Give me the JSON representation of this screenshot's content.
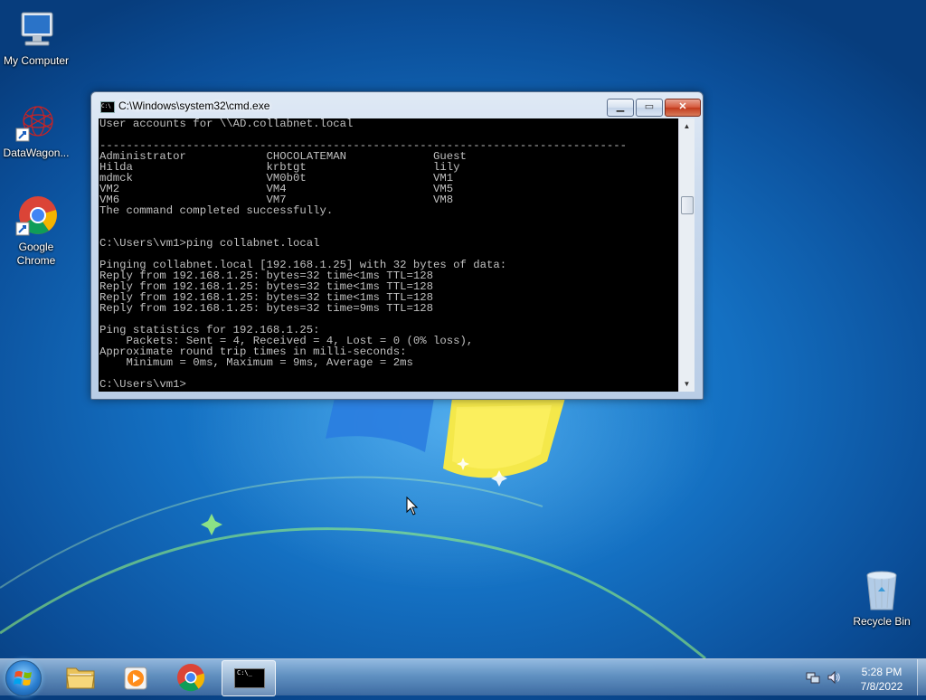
{
  "desktop": {
    "icons": [
      {
        "label": "My Computer",
        "icon": "computer-icon"
      },
      {
        "label": "DataWagon...",
        "icon": "datawagon-icon"
      },
      {
        "label": "Google Chrome",
        "icon": "chrome-icon"
      },
      {
        "label": "Recycle Bin",
        "icon": "recycle-bin-icon"
      }
    ]
  },
  "window": {
    "title": "C:\\Windows\\system32\\cmd.exe",
    "min_glyph": "▁",
    "max_glyph": "▭",
    "close_glyph": "✕",
    "console_lines": [
      "User accounts for \\\\AD.collabnet.local",
      "",
      "-------------------------------------------------------------------------------",
      "Administrator            CHOCOLATEMAN             Guest",
      "Hilda                    krbtgt                   lily",
      "mdmck                    VM0b0t                   VM1",
      "VM2                      VM4                      VM5",
      "VM6                      VM7                      VM8",
      "The command completed successfully.",
      "",
      "",
      "C:\\Users\\vm1>ping collabnet.local",
      "",
      "Pinging collabnet.local [192.168.1.25] with 32 bytes of data:",
      "Reply from 192.168.1.25: bytes=32 time<1ms TTL=128",
      "Reply from 192.168.1.25: bytes=32 time<1ms TTL=128",
      "Reply from 192.168.1.25: bytes=32 time<1ms TTL=128",
      "Reply from 192.168.1.25: bytes=32 time=9ms TTL=128",
      "",
      "Ping statistics for 192.168.1.25:",
      "    Packets: Sent = 4, Received = 4, Lost = 0 (0% loss),",
      "Approximate round trip times in milli-seconds:",
      "    Minimum = 0ms, Maximum = 9ms, Average = 2ms",
      "",
      "C:\\Users\\vm1>"
    ]
  },
  "taskbar": {
    "items": [
      {
        "icon": "file-explorer-icon"
      },
      {
        "icon": "media-player-icon"
      },
      {
        "icon": "chrome-icon"
      },
      {
        "icon": "cmd-icon",
        "active": true,
        "glyph": "C:\\_"
      }
    ],
    "clock": {
      "time": "5:28 PM",
      "date": "7/8/2022"
    }
  },
  "colors": {
    "console_bg": "#000000",
    "console_fg": "#c0c0c0",
    "desktop_blue": "#1470c2"
  }
}
